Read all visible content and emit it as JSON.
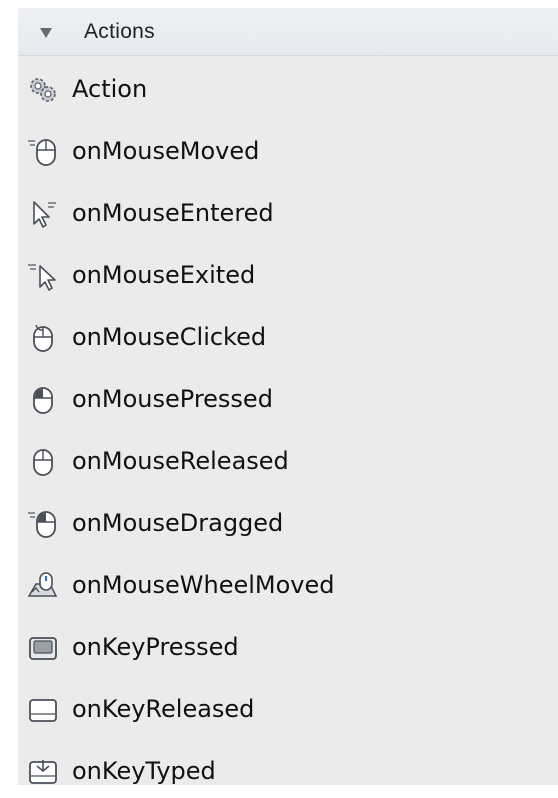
{
  "panel": {
    "header": {
      "title": "Actions"
    },
    "items": [
      {
        "label": "Action",
        "icon": "gears-icon"
      },
      {
        "label": "onMouseMoved",
        "icon": "mouse-moved-icon"
      },
      {
        "label": "onMouseEntered",
        "icon": "cursor-entered-icon"
      },
      {
        "label": "onMouseExited",
        "icon": "cursor-exited-icon"
      },
      {
        "label": "onMouseClicked",
        "icon": "mouse-clicked-icon"
      },
      {
        "label": "onMousePressed",
        "icon": "mouse-pressed-icon"
      },
      {
        "label": "onMouseReleased",
        "icon": "mouse-released-icon"
      },
      {
        "label": "onMouseDragged",
        "icon": "mouse-dragged-icon"
      },
      {
        "label": "onMouseWheelMoved",
        "icon": "mouse-wheel-icon"
      },
      {
        "label": "onKeyPressed",
        "icon": "key-pressed-icon"
      },
      {
        "label": "onKeyReleased",
        "icon": "key-released-icon"
      },
      {
        "label": "onKeyTyped",
        "icon": "key-typed-icon"
      }
    ]
  }
}
